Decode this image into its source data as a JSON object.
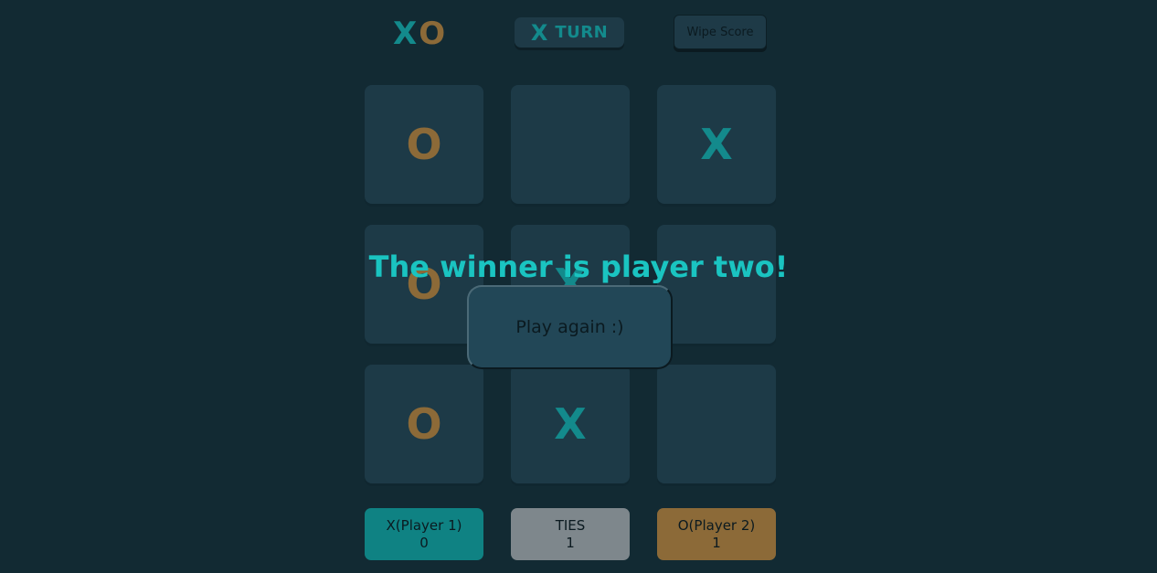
{
  "colors": {
    "background": "#122a33",
    "x_mark": "#138a8c",
    "o_mark": "#8c6a38",
    "winner_text": "#1ac4c1",
    "x_score_bg": "#0f8283",
    "ties_score_bg": "#7e878c",
    "o_score_bg": "#8c6a38"
  },
  "header": {
    "logo_x": "X",
    "logo_o": "O",
    "turn_mark": "X",
    "turn_label": "TURN",
    "wipe_label": "Wipe Score"
  },
  "board": {
    "cells": [
      "O",
      "",
      "X",
      "O",
      "X",
      "",
      "O",
      "X",
      ""
    ]
  },
  "scores": {
    "x": {
      "label": "X(Player 1)",
      "value": "0"
    },
    "ties": {
      "label": "TIES",
      "value": "1"
    },
    "o": {
      "label": "O(Player 2)",
      "value": "1"
    }
  },
  "result": {
    "message": "The winner is player two!",
    "play_again_label": "Play again :)"
  }
}
